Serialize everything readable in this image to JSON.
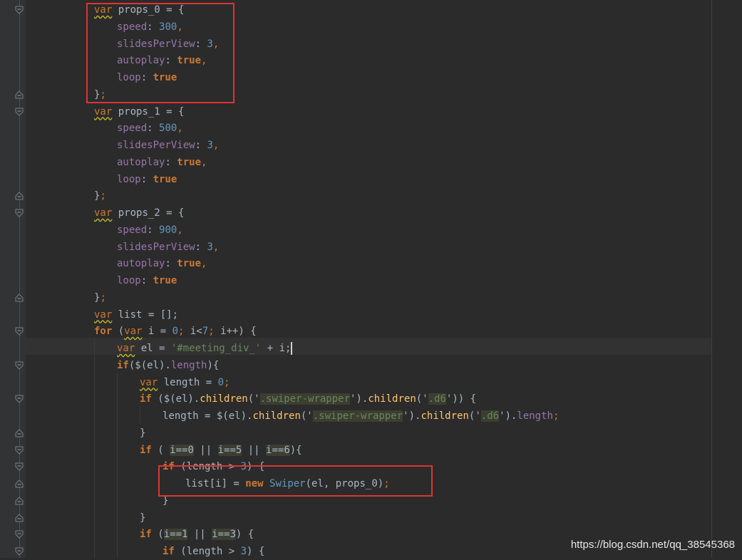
{
  "editor": {
    "lines": [
      {
        "tokens": [
          {
            "t": "var",
            "c": "kw wavy"
          },
          {
            "t": " props_0 = {",
            "c": "plain"
          }
        ]
      },
      {
        "tokens": [
          {
            "t": "speed",
            "c": "prop"
          },
          {
            "t": ": ",
            "c": "plain"
          },
          {
            "t": "300",
            "c": "num"
          },
          {
            "t": ",",
            "c": "punc"
          }
        ]
      },
      {
        "tokens": [
          {
            "t": "slidesPerView",
            "c": "prop"
          },
          {
            "t": ": ",
            "c": "plain"
          },
          {
            "t": "3",
            "c": "num"
          },
          {
            "t": ",",
            "c": "punc"
          }
        ]
      },
      {
        "tokens": [
          {
            "t": "autoplay",
            "c": "prop"
          },
          {
            "t": ": ",
            "c": "plain"
          },
          {
            "t": "true",
            "c": "kwb"
          },
          {
            "t": ",",
            "c": "punc"
          }
        ]
      },
      {
        "tokens": [
          {
            "t": "loop",
            "c": "prop"
          },
          {
            "t": ": ",
            "c": "plain"
          },
          {
            "t": "true",
            "c": "kwb"
          }
        ]
      },
      {
        "tokens": [
          {
            "t": "}",
            "c": "plain"
          },
          {
            "t": ";",
            "c": "punc"
          }
        ]
      },
      {
        "tokens": [
          {
            "t": "var",
            "c": "kw wavy"
          },
          {
            "t": " props_1 = {",
            "c": "plain"
          }
        ]
      },
      {
        "tokens": [
          {
            "t": "speed",
            "c": "prop"
          },
          {
            "t": ": ",
            "c": "plain"
          },
          {
            "t": "500",
            "c": "num"
          },
          {
            "t": ",",
            "c": "punc"
          }
        ]
      },
      {
        "tokens": [
          {
            "t": "slidesPerView",
            "c": "prop"
          },
          {
            "t": ": ",
            "c": "plain"
          },
          {
            "t": "3",
            "c": "num"
          },
          {
            "t": ",",
            "c": "punc"
          }
        ]
      },
      {
        "tokens": [
          {
            "t": "autoplay",
            "c": "prop"
          },
          {
            "t": ": ",
            "c": "plain"
          },
          {
            "t": "true",
            "c": "kwb"
          },
          {
            "t": ",",
            "c": "punc"
          }
        ]
      },
      {
        "tokens": [
          {
            "t": "loop",
            "c": "prop"
          },
          {
            "t": ": ",
            "c": "plain"
          },
          {
            "t": "true",
            "c": "kwb"
          }
        ]
      },
      {
        "tokens": [
          {
            "t": "}",
            "c": "plain"
          },
          {
            "t": ";",
            "c": "punc"
          }
        ]
      },
      {
        "tokens": [
          {
            "t": "var",
            "c": "kw wavy"
          },
          {
            "t": " props_2 = {",
            "c": "plain"
          }
        ]
      },
      {
        "tokens": [
          {
            "t": "speed",
            "c": "prop"
          },
          {
            "t": ": ",
            "c": "plain"
          },
          {
            "t": "900",
            "c": "num"
          },
          {
            "t": ",",
            "c": "punc"
          }
        ]
      },
      {
        "tokens": [
          {
            "t": "slidesPerView",
            "c": "prop"
          },
          {
            "t": ": ",
            "c": "plain"
          },
          {
            "t": "3",
            "c": "num"
          },
          {
            "t": ",",
            "c": "punc"
          }
        ]
      },
      {
        "tokens": [
          {
            "t": "autoplay",
            "c": "prop"
          },
          {
            "t": ": ",
            "c": "plain"
          },
          {
            "t": "true",
            "c": "kwb"
          },
          {
            "t": ",",
            "c": "punc"
          }
        ]
      },
      {
        "tokens": [
          {
            "t": "loop",
            "c": "prop"
          },
          {
            "t": ": ",
            "c": "plain"
          },
          {
            "t": "true",
            "c": "kwb"
          }
        ]
      },
      {
        "tokens": [
          {
            "t": "}",
            "c": "plain"
          },
          {
            "t": ";",
            "c": "punc"
          }
        ]
      },
      {
        "tokens": [
          {
            "t": "var",
            "c": "kw wavy"
          },
          {
            "t": " list = [];",
            "c": "plain"
          }
        ]
      },
      {
        "tokens": [
          {
            "t": "for",
            "c": "kwb"
          },
          {
            "t": " (",
            "c": "plain"
          },
          {
            "t": "var",
            "c": "kw wavy"
          },
          {
            "t": " i = ",
            "c": "plain"
          },
          {
            "t": "0",
            "c": "num"
          },
          {
            "t": "; ",
            "c": "punc"
          },
          {
            "t": "i<",
            "c": "plain"
          },
          {
            "t": "7",
            "c": "num"
          },
          {
            "t": "; ",
            "c": "punc"
          },
          {
            "t": "i++) {",
            "c": "plain"
          }
        ]
      },
      {
        "tokens": [
          {
            "t": "var",
            "c": "kw wavy"
          },
          {
            "t": " el = ",
            "c": "plain"
          },
          {
            "t": "'#meeting_div_'",
            "c": "str"
          },
          {
            "t": " + i;",
            "c": "plain"
          }
        ]
      },
      {
        "tokens": [
          {
            "t": "if",
            "c": "kwb"
          },
          {
            "t": "($(el).",
            "c": "plain"
          },
          {
            "t": "length",
            "c": "prop"
          },
          {
            "t": "){",
            "c": "plain"
          }
        ]
      },
      {
        "tokens": [
          {
            "t": "var",
            "c": "kw wavy"
          },
          {
            "t": " length = ",
            "c": "plain"
          },
          {
            "t": "0",
            "c": "num"
          },
          {
            "t": ";",
            "c": "punc"
          }
        ]
      },
      {
        "tokens": [
          {
            "t": "if",
            "c": "kwb"
          },
          {
            "t": " ($(el).",
            "c": "plain"
          },
          {
            "t": "children",
            "c": "fn"
          },
          {
            "t": "('",
            "c": "plain"
          },
          {
            "t": ".swiper-wrapper",
            "c": "str hl"
          },
          {
            "t": "').",
            "c": "plain"
          },
          {
            "t": "children",
            "c": "fn"
          },
          {
            "t": "('",
            "c": "plain"
          },
          {
            "t": ".d6",
            "c": "str hl"
          },
          {
            "t": "')) {",
            "c": "plain"
          }
        ]
      },
      {
        "tokens": [
          {
            "t": "length = $(el).",
            "c": "plain"
          },
          {
            "t": "children",
            "c": "fn"
          },
          {
            "t": "('",
            "c": "plain"
          },
          {
            "t": ".swiper-wrapper",
            "c": "str hl"
          },
          {
            "t": "').",
            "c": "plain"
          },
          {
            "t": "children",
            "c": "fn"
          },
          {
            "t": "('",
            "c": "plain"
          },
          {
            "t": ".d6",
            "c": "str hl"
          },
          {
            "t": "').",
            "c": "plain"
          },
          {
            "t": "length",
            "c": "prop"
          },
          {
            "t": ";",
            "c": "punc"
          }
        ]
      },
      {
        "tokens": [
          {
            "t": "}",
            "c": "plain"
          }
        ]
      },
      {
        "tokens": [
          {
            "t": "if",
            "c": "kwb"
          },
          {
            "t": " ( ",
            "c": "plain"
          },
          {
            "t": "i==0",
            "c": "plain hl"
          },
          {
            "t": " || ",
            "c": "plain"
          },
          {
            "t": "i==5",
            "c": "plain hl"
          },
          {
            "t": " || ",
            "c": "plain"
          },
          {
            "t": "i==6",
            "c": "plain hl"
          },
          {
            "t": "){",
            "c": "plain"
          }
        ]
      },
      {
        "tokens": [
          {
            "t": "if",
            "c": "kwb"
          },
          {
            "t": " (length > ",
            "c": "plain"
          },
          {
            "t": "3",
            "c": "num"
          },
          {
            "t": ") {",
            "c": "plain"
          }
        ]
      },
      {
        "tokens": [
          {
            "t": "list[i] = ",
            "c": "plain"
          },
          {
            "t": "new",
            "c": "kwb"
          },
          {
            "t": " ",
            "c": "plain"
          },
          {
            "t": "Swiper",
            "c": "cls"
          },
          {
            "t": "(el, props_0)",
            "c": "plain"
          },
          {
            "t": ";",
            "c": "punc"
          }
        ]
      },
      {
        "tokens": [
          {
            "t": "}",
            "c": "plain"
          }
        ]
      },
      {
        "tokens": [
          {
            "t": "}",
            "c": "plain"
          }
        ]
      },
      {
        "tokens": [
          {
            "t": "if",
            "c": "kwb"
          },
          {
            "t": " (",
            "c": "plain"
          },
          {
            "t": "i==1",
            "c": "plain hl"
          },
          {
            "t": " || ",
            "c": "plain"
          },
          {
            "t": "i==3",
            "c": "plain hl"
          },
          {
            "t": ") {",
            "c": "plain"
          }
        ]
      },
      {
        "tokens": [
          {
            "t": "if",
            "c": "kwb"
          },
          {
            "t": " (length > ",
            "c": "plain"
          },
          {
            "t": "3",
            "c": "num"
          },
          {
            "t": ") {",
            "c": "plain"
          }
        ]
      }
    ]
  },
  "watermark": "https://blog.csdn.net/qq_38545368",
  "icons": {
    "fold_open": "fold-open-icon",
    "fold_close": "fold-close-icon"
  },
  "colors": {
    "background": "#2b2b2b",
    "highlight_box": "#e03333"
  }
}
